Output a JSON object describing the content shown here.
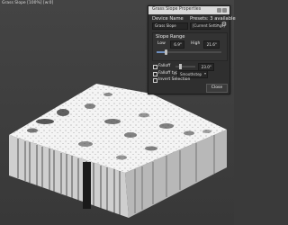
{
  "viewport": {
    "title": "Grass Slope [100%] [w:0]"
  },
  "panel": {
    "title": "Grass Slope Properties",
    "device_name_label": "Device Name",
    "device_name_value": "Grass Slope",
    "presets_label": "Presets: 3 available",
    "preset_value": "[Current Settings]",
    "slope_range_label": "Slope Range",
    "low_label": "Low",
    "low_value": "6.9°",
    "high_label": "High",
    "high_value": "21.6°",
    "slope_range_fraction": 0.14,
    "falloff_label": "Falloff",
    "falloff_value": "23.0°",
    "falloff_type_label": "Falloff type",
    "falloff_type_value": "Smoothstep",
    "invert_label": "Invert Selection",
    "close_label": "Close"
  }
}
